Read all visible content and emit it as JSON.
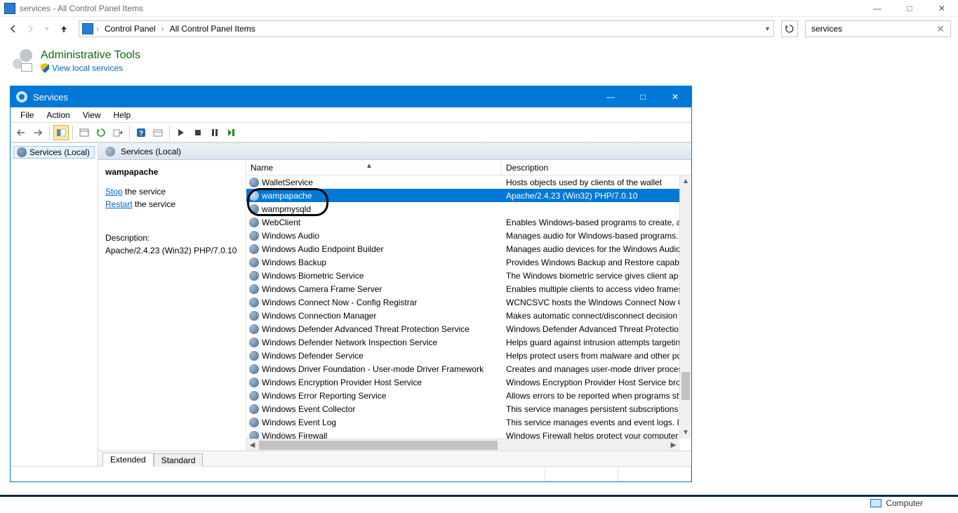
{
  "explorer": {
    "window_title": "services - All Control Panel Items",
    "crumb1": "Control Panel",
    "crumb2": "All Control Panel Items",
    "search_value": "services"
  },
  "cp": {
    "heading": "Administrative Tools",
    "link": "View local services"
  },
  "services": {
    "title": "Services",
    "menus": {
      "file": "File",
      "action": "Action",
      "view": "View",
      "help": "Help"
    },
    "tree_node": "Services (Local)",
    "right_header": "Services (Local)",
    "task": {
      "selected": "wampapache",
      "stop_link": "Stop",
      "stop_suffix": " the service",
      "restart_link": "Restart",
      "restart_suffix": " the service",
      "desc_label": "Description:",
      "desc_value": "Apache/2.4.23 (Win32) PHP/7.0.10"
    },
    "columns": {
      "name": "Name",
      "desc": "Description"
    },
    "rows": [
      {
        "name": "WalletService",
        "desc": "Hosts objects used by clients of the wallet",
        "selected": false
      },
      {
        "name": "wampapache",
        "desc": "Apache/2.4.23 (Win32) PHP/7.0.10",
        "selected": true
      },
      {
        "name": "wampmysqld",
        "desc": "",
        "selected": false
      },
      {
        "name": "WebClient",
        "desc": "Enables Windows-based programs to create, ac",
        "selected": false
      },
      {
        "name": "Windows Audio",
        "desc": "Manages audio for Windows-based programs.",
        "selected": false
      },
      {
        "name": "Windows Audio Endpoint Builder",
        "desc": "Manages audio devices for the Windows Audio",
        "selected": false
      },
      {
        "name": "Windows Backup",
        "desc": "Provides Windows Backup and Restore capabili",
        "selected": false
      },
      {
        "name": "Windows Biometric Service",
        "desc": "The Windows biometric service gives client ap",
        "selected": false
      },
      {
        "name": "Windows Camera Frame Server",
        "desc": "Enables multiple clients to access video frames",
        "selected": false
      },
      {
        "name": "Windows Connect Now - Config Registrar",
        "desc": "WCNCSVC hosts the Windows Connect Now C",
        "selected": false
      },
      {
        "name": "Windows Connection Manager",
        "desc": "Makes automatic connect/disconnect decision",
        "selected": false
      },
      {
        "name": "Windows Defender Advanced Threat Protection Service",
        "desc": "Windows Defender Advanced Threat Protectio",
        "selected": false
      },
      {
        "name": "Windows Defender Network Inspection Service",
        "desc": "Helps guard against intrusion attempts targetin",
        "selected": false
      },
      {
        "name": "Windows Defender Service",
        "desc": "Helps protect users from malware and other po",
        "selected": false
      },
      {
        "name": "Windows Driver Foundation - User-mode Driver Framework",
        "desc": "Creates and manages user-mode driver proces",
        "selected": false
      },
      {
        "name": "Windows Encryption Provider Host Service",
        "desc": "Windows Encryption Provider Host Service bro",
        "selected": false
      },
      {
        "name": "Windows Error Reporting Service",
        "desc": "Allows errors to be reported when programs st",
        "selected": false
      },
      {
        "name": "Windows Event Collector",
        "desc": "This service manages persistent subscriptions t",
        "selected": false
      },
      {
        "name": "Windows Event Log",
        "desc": "This service manages events and event logs. It",
        "selected": false
      },
      {
        "name": "Windows Firewall",
        "desc": "Windows Firewall helps protect your computer",
        "selected": false
      }
    ],
    "tabs": {
      "extended": "Extended",
      "standard": "Standard"
    }
  },
  "tray": {
    "label": "Computer"
  }
}
